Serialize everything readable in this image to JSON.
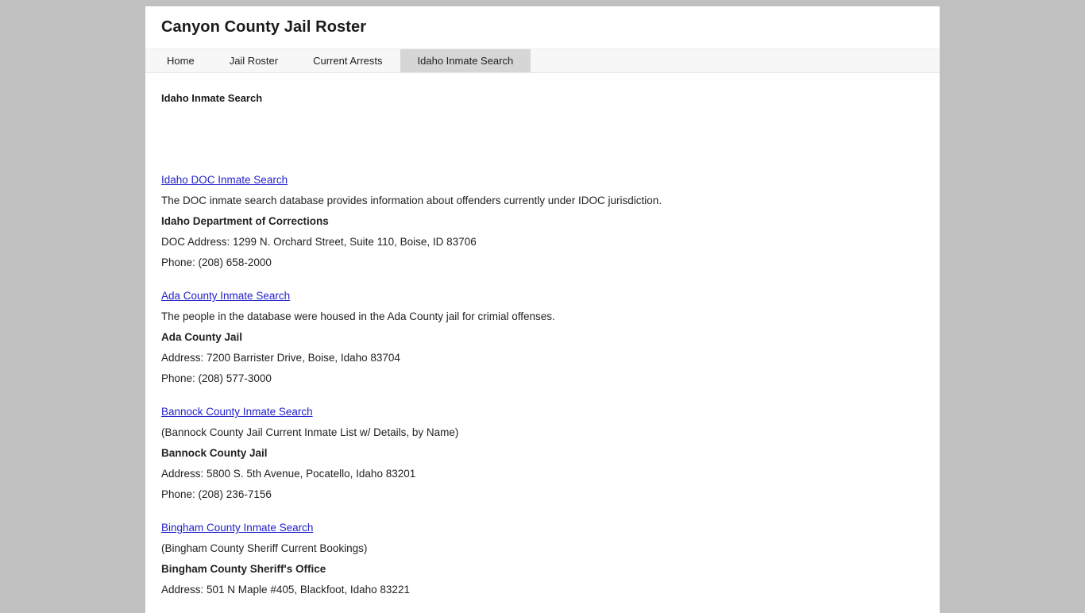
{
  "site": {
    "title": "Canyon County Jail Roster"
  },
  "nav": {
    "items": [
      {
        "label": "Home",
        "active": false
      },
      {
        "label": "Jail Roster",
        "active": false
      },
      {
        "label": "Current Arrests",
        "active": false
      },
      {
        "label": "Idaho Inmate Search",
        "active": true
      }
    ]
  },
  "content": {
    "heading": "Idaho Inmate Search",
    "blocks": [
      {
        "link_label": "Idaho DOC Inmate Search",
        "description": "The DOC inmate search database provides information about offenders currently under IDOC jurisdiction.",
        "org_name": "Idaho Department of Corrections",
        "address": "DOC Address: 1299 N. Orchard Street, Suite 110, Boise, ID 83706",
        "phone": "Phone: (208) 658-2000"
      },
      {
        "link_label": "Ada County Inmate Search",
        "description": "The people in the database were housed in the Ada County jail for crimial offenses.",
        "org_name": "Ada County Jail",
        "address": "Address: 7200 Barrister Drive, Boise, Idaho 83704",
        "phone": "Phone: (208) 577-3000"
      },
      {
        "link_label": "Bannock County Inmate Search",
        "description": "(Bannock County Jail Current Inmate List w/ Details, by Name)",
        "org_name": "Bannock County Jail",
        "address": "Address: 5800 S. 5th Avenue, Pocatello, Idaho 83201",
        "phone": "Phone: (208) 236-7156"
      },
      {
        "link_label": "Bingham County Inmate Search",
        "description": "(Bingham County Sheriff Current Bookings)",
        "org_name": "Bingham County Sheriff's Office",
        "address": "Address: 501 N Maple #405, Blackfoot, Idaho 83221",
        "phone": ""
      }
    ]
  },
  "colors": {
    "page_background": "#c0c0c0",
    "container_background": "#ffffff",
    "nav_background": "#f7f7f7",
    "nav_active_background": "#d6d6d6",
    "link_color": "#2222cc",
    "text_color": "#222222"
  }
}
